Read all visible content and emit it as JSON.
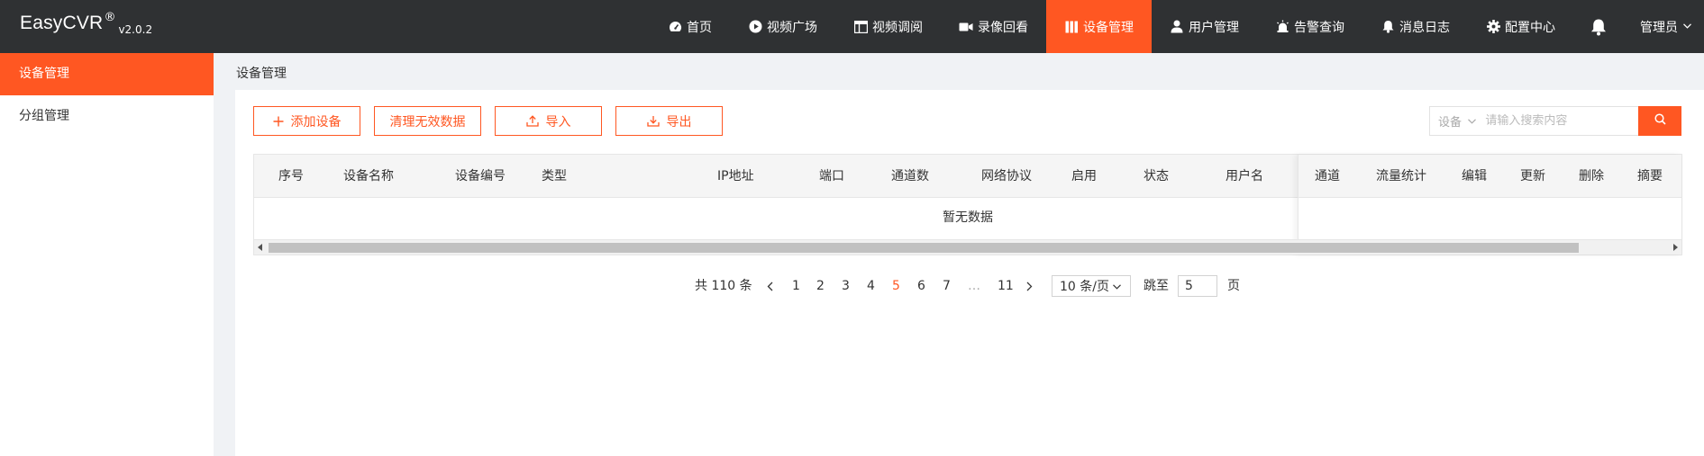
{
  "brand": {
    "name": "EasyCVR",
    "reg": "®",
    "version": "v2.0.2"
  },
  "nav": [
    {
      "label": "首页",
      "icon": "dashboard-icon",
      "active": false
    },
    {
      "label": "视频广场",
      "icon": "play-circle-icon",
      "active": false
    },
    {
      "label": "视频调阅",
      "icon": "layout-icon",
      "active": false
    },
    {
      "label": "录像回看",
      "icon": "video-camera-icon",
      "active": false
    },
    {
      "label": "设备管理",
      "icon": "device-icon",
      "active": true
    },
    {
      "label": "用户管理",
      "icon": "user-icon",
      "active": false
    },
    {
      "label": "告警查询",
      "icon": "alarm-icon",
      "active": false
    },
    {
      "label": "消息日志",
      "icon": "bell-icon",
      "active": false
    },
    {
      "label": "配置中心",
      "icon": "gear-icon",
      "active": false
    }
  ],
  "user": {
    "label": "管理员"
  },
  "sidebar": {
    "items": [
      {
        "label": "设备管理",
        "active": true
      },
      {
        "label": "分组管理",
        "active": false
      }
    ]
  },
  "breadcrumb": "设备管理",
  "toolbar": {
    "add": "添加设备",
    "clean": "清理无效数据",
    "import": "导入",
    "export": "导出"
  },
  "search": {
    "select": "设备",
    "placeholder": "请输入搜索内容"
  },
  "table": {
    "columns": [
      "序号",
      "设备名称",
      "设备编号",
      "类型",
      "IP地址",
      "端口",
      "通道数",
      "网络协议",
      "启用",
      "状态",
      "用户名"
    ],
    "fixed_columns": [
      "通道",
      "流量统计",
      "编辑",
      "更新",
      "删除",
      "摘要"
    ],
    "empty_text": "暂无数据"
  },
  "pagination": {
    "total_text": "共 110 条",
    "pages": [
      "1",
      "2",
      "3",
      "4",
      "5",
      "6",
      "7",
      "…",
      "11"
    ],
    "current": "5",
    "page_size": "10 条/页",
    "jump_label": "跳至",
    "jump_value": "5",
    "page_suffix": "页"
  },
  "colors": {
    "accent": "#ff5722",
    "topbar": "#2f3133"
  }
}
